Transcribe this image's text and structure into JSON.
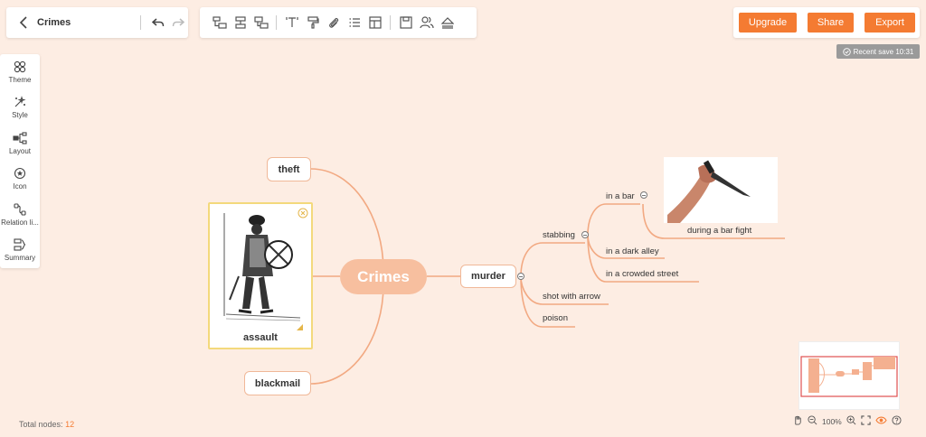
{
  "header": {
    "title": "Crimes"
  },
  "actions": {
    "upgrade": "Upgrade",
    "share": "Share",
    "export": "Export"
  },
  "save_status": "Recent save 10:31",
  "sidebar": {
    "items": [
      {
        "label": "Theme",
        "icon": "theme-icon"
      },
      {
        "label": "Style",
        "icon": "style-icon"
      },
      {
        "label": "Layout",
        "icon": "layout-icon"
      },
      {
        "label": "Icon",
        "icon": "icon-icon"
      },
      {
        "label": "Relation li...",
        "icon": "relation-line-icon"
      },
      {
        "label": "Summary",
        "icon": "summary-icon"
      }
    ]
  },
  "map": {
    "root": "Crimes",
    "topics": {
      "theft": "theft",
      "assault": "assault",
      "blackmail": "blackmail",
      "murder": "murder"
    },
    "murder_children": {
      "stabbing": "stabbing",
      "shot_with_arrow": "shot with arrow",
      "poison": "poison"
    },
    "stabbing_children": {
      "in_a_bar": "in a bar",
      "in_a_dark_alley": "in a dark alley",
      "in_a_crowded_street": "in a crowded street"
    },
    "in_a_bar_children": {
      "during_a_bar_fight": "during a bar fight"
    }
  },
  "footer": {
    "total_nodes_label": "Total nodes:",
    "total_nodes_count": "12",
    "zoom": "100%"
  },
  "colors": {
    "accent": "#f47b32",
    "background": "#fdede3",
    "root_fill": "#f7bf9f",
    "branch_line": "#f2a982"
  }
}
